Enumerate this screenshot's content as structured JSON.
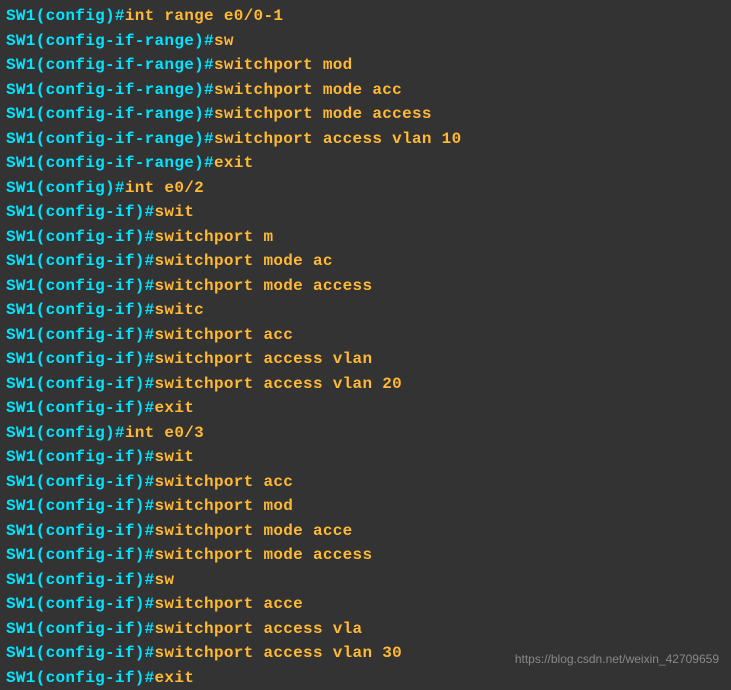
{
  "lines": [
    {
      "prompt": "SW1(config)#",
      "command": "int range e0/0-1"
    },
    {
      "prompt": "SW1(config-if-range)#",
      "command": "sw"
    },
    {
      "prompt": "SW1(config-if-range)#",
      "command": "switchport mod"
    },
    {
      "prompt": "SW1(config-if-range)#",
      "command": "switchport mode acc"
    },
    {
      "prompt": "SW1(config-if-range)#",
      "command": "switchport mode access"
    },
    {
      "prompt": "SW1(config-if-range)#",
      "command": "switchport access vlan 10"
    },
    {
      "prompt": "SW1(config-if-range)#",
      "command": "exit"
    },
    {
      "prompt": "SW1(config)#",
      "command": "int e0/2"
    },
    {
      "prompt": "SW1(config-if)#",
      "command": "swit"
    },
    {
      "prompt": "SW1(config-if)#",
      "command": "switchport m"
    },
    {
      "prompt": "SW1(config-if)#",
      "command": "switchport mode ac"
    },
    {
      "prompt": "SW1(config-if)#",
      "command": "switchport mode access"
    },
    {
      "prompt": "SW1(config-if)#",
      "command": "switc"
    },
    {
      "prompt": "SW1(config-if)#",
      "command": "switchport acc"
    },
    {
      "prompt": "SW1(config-if)#",
      "command": "switchport access vlan"
    },
    {
      "prompt": "SW1(config-if)#",
      "command": "switchport access vlan 20"
    },
    {
      "prompt": "SW1(config-if)#",
      "command": "exit"
    },
    {
      "prompt": "SW1(config)#",
      "command": "int e0/3"
    },
    {
      "prompt": "SW1(config-if)#",
      "command": "swit"
    },
    {
      "prompt": "SW1(config-if)#",
      "command": "switchport acc"
    },
    {
      "prompt": "SW1(config-if)#",
      "command": "switchport mod"
    },
    {
      "prompt": "SW1(config-if)#",
      "command": "switchport mode acce"
    },
    {
      "prompt": "SW1(config-if)#",
      "command": "switchport mode access"
    },
    {
      "prompt": "SW1(config-if)#",
      "command": "sw"
    },
    {
      "prompt": "SW1(config-if)#",
      "command": "switchport acce"
    },
    {
      "prompt": "SW1(config-if)#",
      "command": "switchport access vla"
    },
    {
      "prompt": "SW1(config-if)#",
      "command": "switchport access vlan 30"
    },
    {
      "prompt": "SW1(config-if)#",
      "command": "exit"
    }
  ],
  "watermark": "https://blog.csdn.net/weixin_42709659"
}
